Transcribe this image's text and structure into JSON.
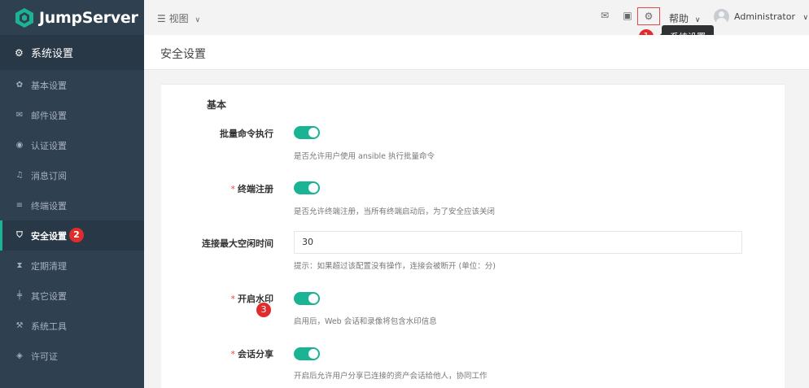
{
  "sidebar": {
    "brand": "JumpServer",
    "header": "系统设置",
    "items": [
      {
        "label": "基本设置",
        "icon": "gear-small-icon",
        "glyph": "✿"
      },
      {
        "label": "邮件设置",
        "icon": "mail-icon",
        "glyph": "✉"
      },
      {
        "label": "认证设置",
        "icon": "user-circle-icon",
        "glyph": "◉"
      },
      {
        "label": "消息订阅",
        "icon": "bell-icon",
        "glyph": "♫"
      },
      {
        "label": "终端设置",
        "icon": "list-icon",
        "glyph": "≡"
      },
      {
        "label": "安全设置",
        "icon": "shield-icon",
        "glyph": "⛉"
      },
      {
        "label": "定期清理",
        "icon": "hourglass-icon",
        "glyph": "⧗"
      },
      {
        "label": "其它设置",
        "icon": "signpost-icon",
        "glyph": "╪"
      },
      {
        "label": "系统工具",
        "icon": "wrench-icon",
        "glyph": "⚒"
      },
      {
        "label": "许可证",
        "icon": "diamond-icon",
        "glyph": "◈"
      }
    ],
    "active_index": 5
  },
  "topbar": {
    "view_label": "视图",
    "help_label": "帮助",
    "user_name": "Administrator"
  },
  "tooltip": "系统设置",
  "badges": [
    "1",
    "2",
    "3"
  ],
  "page": {
    "title": "安全设置",
    "section": "基本",
    "fields": {
      "batch": {
        "label": "批量命令执行",
        "help": "是否允许用户使用 ansible 执行批量命令",
        "enabled": true
      },
      "terminal": {
        "label": "终端注册",
        "help": "是否允许终端注册，当所有终端启动后，为了安全应该关闭",
        "enabled": true,
        "required": true
      },
      "idle": {
        "label": "连接最大空闲时间",
        "value": "30",
        "help": "提示：如果超过该配置没有操作，连接会被断开 (单位：分)"
      },
      "watermark": {
        "label": "开启水印",
        "help": "启用后，Web 会话和录像将包含水印信息",
        "enabled": true,
        "required": true
      },
      "share": {
        "label": "会话分享",
        "help": "开启后允许用户分享已连接的资产会话给他人，协同工作",
        "enabled": true,
        "required": true
      }
    }
  },
  "colors": {
    "accent": "#1ab394",
    "sidebar": "#2f4050",
    "badge": "#e02c2c"
  }
}
